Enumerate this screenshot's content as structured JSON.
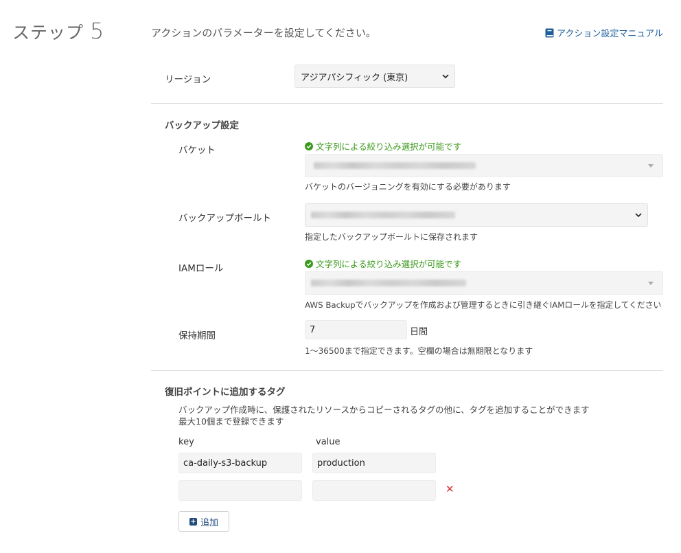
{
  "header": {
    "step_label": "ステップ",
    "step_number": "5",
    "description": "アクションのパラメーターを設定してください。",
    "manual_link": "アクション設定マニュアル"
  },
  "region": {
    "label": "リージョン",
    "value": "アジアパシフィック (東京)"
  },
  "backup": {
    "section_title": "バックアップ設定",
    "bucket": {
      "label": "バケット",
      "filter_hint": "文字列による絞り込み選択が可能です",
      "help": "バケットのバージョニングを有効にする必要があります"
    },
    "vault": {
      "label": "バックアップボールト",
      "help": "指定したバックアップボールトに保存されます"
    },
    "iam": {
      "label": "IAMロール",
      "filter_hint": "文字列による絞り込み選択が可能です",
      "help": "AWS Backupでバックアップを作成および管理するときに引き継ぐIAMロールを指定してください"
    },
    "retention": {
      "label": "保持期間",
      "value": "7",
      "unit": "日間",
      "help": "1〜36500まで指定できます。空欄の場合は無期限となります"
    }
  },
  "tags": {
    "section_title": "復旧ポイントに追加するタグ",
    "desc_line1": "バックアップ作成時に、保護されたリソースからコピーされるタグの他に、タグを追加することができます",
    "desc_line2": "最大10個まで登録できます",
    "key_header": "key",
    "value_header": "value",
    "rows": [
      {
        "key": "ca-daily-s3-backup",
        "value": "production"
      },
      {
        "key": "",
        "value": ""
      }
    ],
    "delete_symbol": "✕",
    "add_button": "追加"
  },
  "colors": {
    "link": "#1f5f9e",
    "success": "#3a9a1a",
    "danger": "#d9342b",
    "field_bg": "#f4f4f4"
  }
}
